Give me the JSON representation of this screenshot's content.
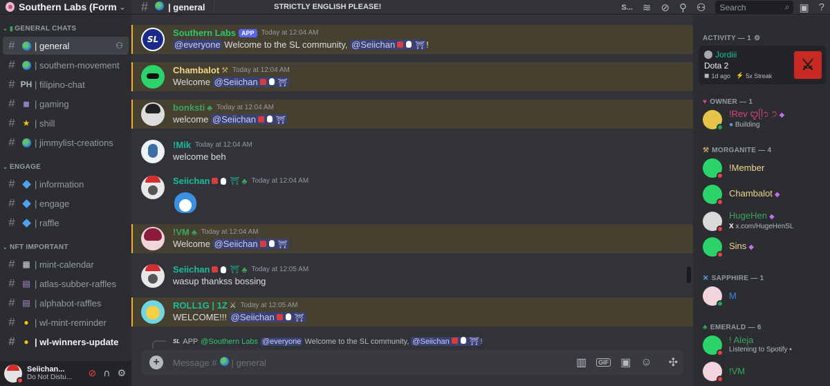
{
  "server": {
    "name": "Southern Labs (Form..."
  },
  "sidebar": {
    "categories": [
      {
        "name": "GENERAL CHATS",
        "channels": [
          {
            "name": "| general",
            "emoji": "globe"
          },
          {
            "name": "| southern-movement",
            "emoji": "globe"
          },
          {
            "name": "| filipino-chat",
            "emoji": "PH"
          },
          {
            "name": "| gaming",
            "emoji": "game-controller"
          },
          {
            "name": "| shill",
            "emoji": "star"
          },
          {
            "name": "| jimmylist-creations",
            "emoji": "globe"
          }
        ]
      },
      {
        "name": "ENGAGE",
        "channels": [
          {
            "name": "| information",
            "emoji": "diamond"
          },
          {
            "name": "| engage",
            "emoji": "diamond"
          },
          {
            "name": "| raffle",
            "emoji": "diamond"
          }
        ]
      },
      {
        "name": "NFT IMPORTANT",
        "channels": [
          {
            "name": "| mint-calendar",
            "emoji": "calendar"
          },
          {
            "name": "| atlas-subber-raffles",
            "emoji": "slot-machine"
          },
          {
            "name": "| alphabot-raffles",
            "emoji": "slot-machine"
          },
          {
            "name": "| wl-mint-reminder",
            "emoji": "lightbulb"
          },
          {
            "name": "| wl-winners-update",
            "emoji": "lightbulb"
          }
        ]
      }
    ]
  },
  "user_panel": {
    "name": "Seiichan...",
    "status": "Do Not Distu..."
  },
  "topbar": {
    "channel": "| general",
    "topic": "STRICTLY ENGLISH PLEASE!",
    "s_label": "S...",
    "search_placeholder": "Search"
  },
  "messages": [
    {
      "author": "Southern Labs",
      "app_badge": "APP",
      "time": "Today at 12:04 AM",
      "mention_all": "@everyone",
      "text": " Welcome to the SL community, ",
      "mention": "@Seiichan",
      "tail": "!",
      "color": "#2dc770"
    },
    {
      "author": "Chambalot",
      "time": "Today at 12:04 AM",
      "prefix": "Welcome ",
      "mention": "@Seiichan",
      "color": "#f0d78c"
    },
    {
      "author": "bonksti",
      "time": "Today at 12:04 AM",
      "prefix": "welcome ",
      "mention": "@Seiichan",
      "color": "#3ba55d"
    },
    {
      "author": "!Mik",
      "time": "Today at 12:04 AM",
      "text": "welcome beh",
      "color": "#1abc9c"
    },
    {
      "author": "Seiichan",
      "time": "Today at 12:04 AM",
      "color": "#1abc9c"
    },
    {
      "author": "!VM",
      "time": "Today at 12:04 AM",
      "prefix": "Welcome ",
      "mention": "@Seiichan",
      "color": "#3ba55d"
    },
    {
      "author": "Seiichan",
      "time": "Today at 12:05 AM",
      "text": "wasup thankss bossing",
      "color": "#1abc9c"
    },
    {
      "author": "ROLL1G | 1Z",
      "time": "Today at 12:05 AM",
      "prefix": "WELCOME!!! ",
      "mention": "@Seiichan",
      "color": "#1abc9c"
    }
  ],
  "reply_preview": {
    "sl_tag": "SL",
    "app": "APP",
    "author": "@Southern Labs",
    "mention_all": "@everyone",
    "text": " Welcome to the SL community, ",
    "mention": "@Seiichan",
    "tail": "!"
  },
  "composer": {
    "placeholder_prefix": "Message #",
    "placeholder_channel": "| general",
    "gif": "GIF"
  },
  "members": {
    "activity_header": "ACTIVITY — 1",
    "activity": {
      "user": "Jordiii",
      "game": "Dota 2",
      "ago": "1d ago",
      "streak": "5x Streak"
    },
    "owner_header": "OWNER — 1",
    "owner": {
      "name": "!Rev ꨄ︎ᥫ᭡ ੭",
      "status": "Building"
    },
    "morganite_header": "MORGANITE — 4",
    "morganite": [
      {
        "name": "!Member",
        "color": "#f0d78c"
      },
      {
        "name": "Chambalot",
        "color": "#f0d78c",
        "sub": ""
      },
      {
        "name": "HugeHen",
        "color": "#3ba55d",
        "sub": "x.com/HugeHenSL"
      },
      {
        "name": "Sins",
        "color": "#f0d78c"
      }
    ],
    "sapphire_header": "SAPPHIRE — 1",
    "sapphire": [
      {
        "name": "M",
        "color": "#3b82f6"
      }
    ],
    "emerald_header": "EMERALD — 6",
    "emerald": [
      {
        "name": "! Aleja",
        "color": "#3ba55d",
        "sub": "Listening to Spotify"
      },
      {
        "name": "!VM",
        "color": "#3ba55d"
      }
    ]
  }
}
